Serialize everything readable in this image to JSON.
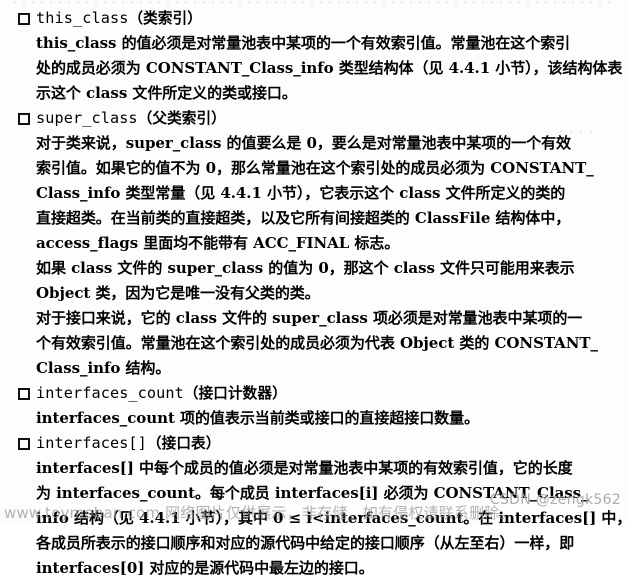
{
  "document": {
    "type": "scanned-book-page",
    "language": "zh-CN",
    "bullet_glyph": "□"
  },
  "sections": [
    {
      "id": "this_class",
      "heading": {
        "code": "this_class",
        "cn": "（类索引）"
      },
      "lines": [
        "this_class 的值必须是对常量池表中某项的一个有效索引值。常量池在这个索引",
        "处的成员必须为 CONSTANT_Class_info 类型结构体（见 4.4.1 小节），该结构体表",
        "示这个 class 文件所定义的类或接口。"
      ]
    },
    {
      "id": "super_class",
      "heading": {
        "code": "super_class",
        "cn": "（父类索引）"
      },
      "lines": [
        "对于类来说，super_class 的值要么是 0，要么是对常量池表中某项的一个有效",
        "索引值。如果它的值不为 0，那么常量池在这个索引处的成员必须为 CONSTANT_",
        "Class_info 类型常量（见 4.4.1 小节），它表示这个 class 文件所定义的类的",
        "直接超类。在当前类的直接超类，以及它所有间接超类的 ClassFile 结构体中，",
        "access_flags 里面均不能带有 ACC_FINAL 标志。",
        "如果 class 文件的 super_class 的值为 0，那这个 class 文件只可能用来表示",
        "Object 类，因为它是唯一没有父类的类。",
        "对于接口来说，它的 class 文件的 super_class 项必须是对常量池表中某项的一",
        "个有效索引值。常量池在这个索引处的成员必须为代表 Object 类的 CONSTANT_",
        "Class_info 结构。"
      ]
    },
    {
      "id": "interfaces_count",
      "heading": {
        "code": "interfaces_count",
        "cn": "（接口计数器）"
      },
      "lines": [
        "interfaces_count 项的值表示当前类或接口的直接超接口数量。"
      ]
    },
    {
      "id": "interfaces",
      "heading": {
        "code": "interfaces[]",
        "cn": "（接口表）"
      },
      "lines": [
        "interfaces[] 中每个成员的值必须是对常量池表中某项的有效索引值，它的长度",
        "为 interfaces_count。每个成员 interfaces[i] 必须为 CONSTANT_Class_",
        "info 结构（见 4.4.1 小节），其中 0 ≤ i<interfaces_count。在 interfaces[] 中，",
        "各成员所表示的接口顺序和对应的源代码中给定的接口顺序（从左至右）一样，即",
        "interfaces[0] 对应的是源代码中最左边的接口。"
      ]
    }
  ],
  "watermarks": {
    "toymoban": "www.toymoban.com 网络图片仅供展示，非存储，如有侵权请联系删除。",
    "csdn": "CSDN @zengk562"
  }
}
